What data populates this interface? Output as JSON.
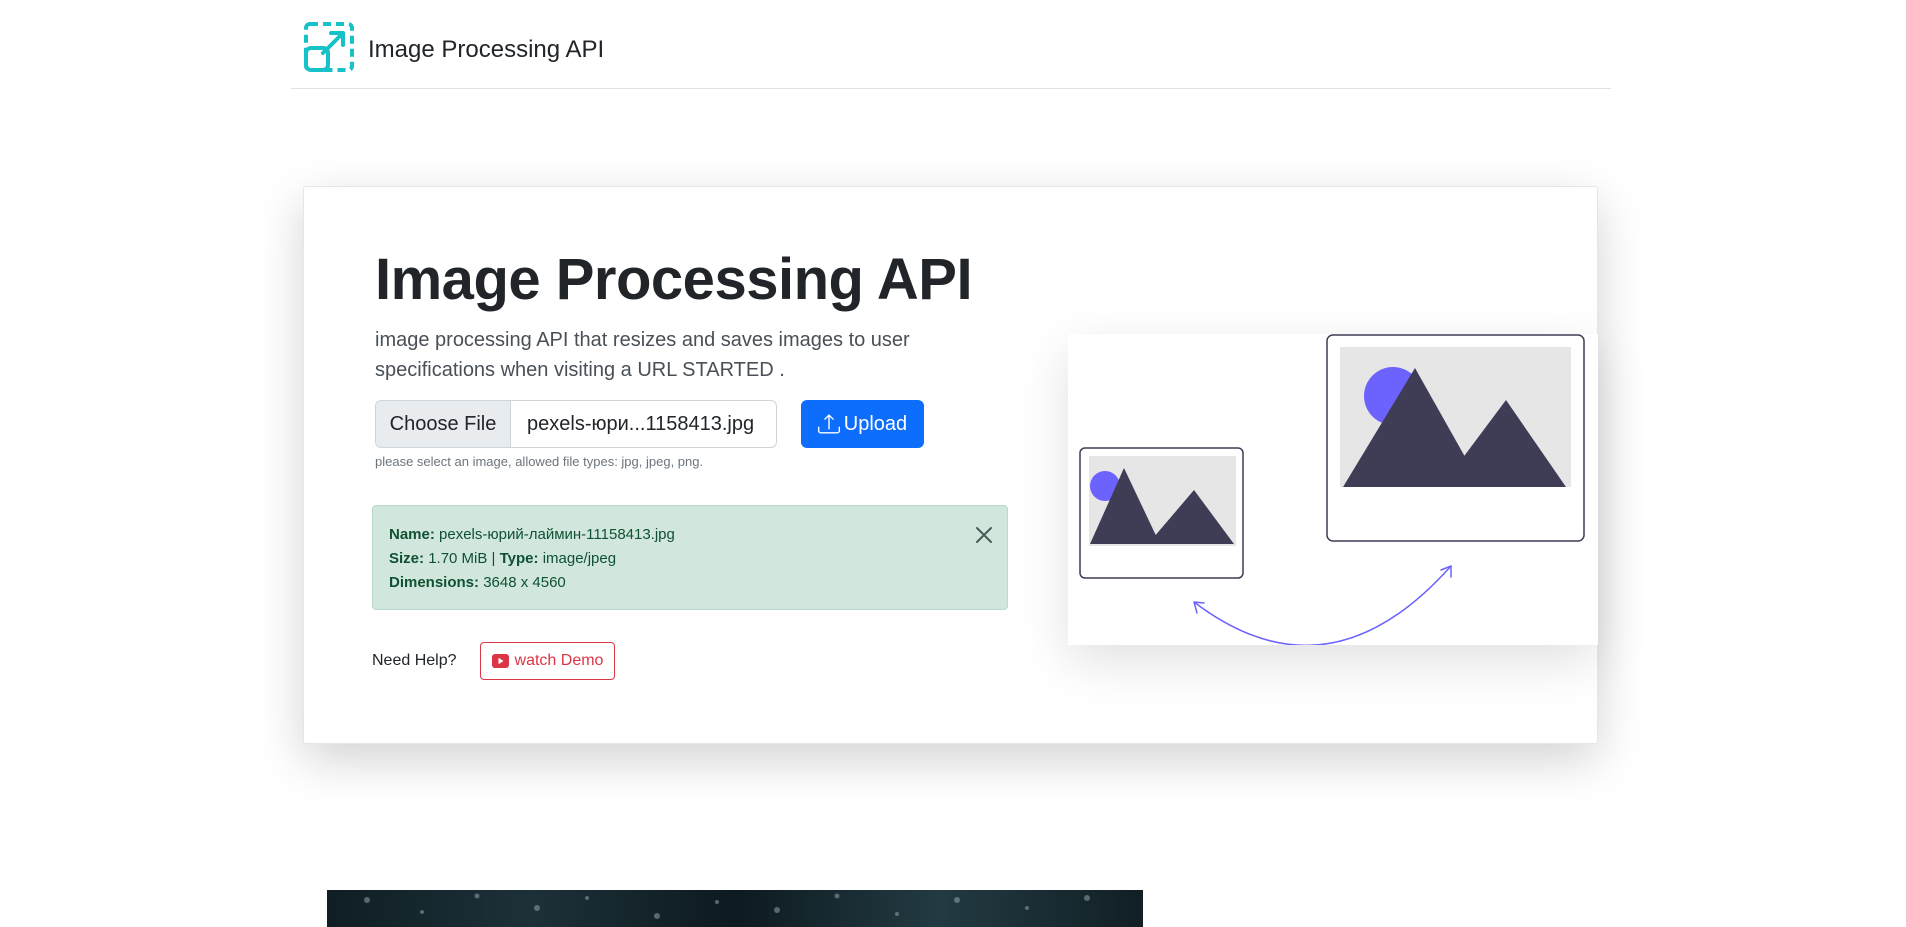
{
  "nav": {
    "brand": "Image Processing API"
  },
  "hero": {
    "title": "Image Processing API",
    "description": "image processing API that resizes and saves images to user specifications when visiting a URL STARTED ."
  },
  "upload": {
    "choose_label": "Choose File",
    "file_name": "pexels-юри...1158413.jpg",
    "button_label": "Upload",
    "help_text": "please select an image, allowed file types: jpg, jpeg, png."
  },
  "file_info": {
    "name_label": "Name:",
    "name_value": "pexels-юрий-лаймин-11158413.jpg",
    "size_label": "Size:",
    "size_value": "1.70 MiB",
    "separator": " | ",
    "type_label": "Type:",
    "type_value": "image/jpeg",
    "dimensions_label": "Dimensions:",
    "dimensions_value": "3648 x 4560"
  },
  "help": {
    "label": "Need Help?",
    "demo_label": "watch Demo"
  },
  "colors": {
    "primary": "#0d6efd",
    "danger": "#dc3545",
    "success_bg": "#d1e7dd",
    "success_text": "#0f5132",
    "illustration_accent": "#6c63ff",
    "illustration_dark": "#3f3d56",
    "logo_teal": "#16c1c8"
  },
  "icons": {
    "logo": "resize-arrow-icon",
    "upload": "upload-icon",
    "close": "close-icon",
    "youtube": "youtube-icon"
  }
}
